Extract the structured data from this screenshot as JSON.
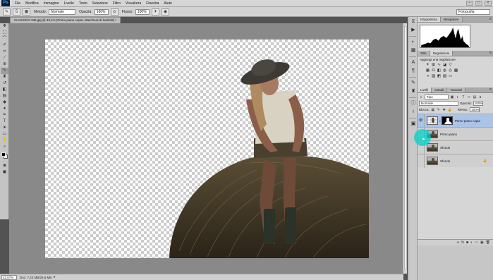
{
  "app": {
    "logo": "Ps"
  },
  "menu": [
    "File",
    "Modifica",
    "Immagine",
    "Livello",
    "Testo",
    "Selezione",
    "Filtro",
    "Visualizza",
    "Finestra",
    "Aiuto"
  ],
  "options": {
    "brush_size": "5",
    "mode_label": "Metodo:",
    "mode_value": "Normale",
    "opacity_label": "Opacità:",
    "opacity_value": "100%",
    "flow_label": "Flusso:",
    "flow_value": "100%",
    "workspace": "Fotografia"
  },
  "document": {
    "tab_title": "CLASSICO 336.jpg @ 43,1% (Primo piano copia, Maschera di livello/8) *",
    "zoom": "43,07%",
    "doc_info": "Doc: 7,43 MB/26,5 MB"
  },
  "panels": {
    "top_tabs": [
      "Istogramma",
      "Navigatore"
    ],
    "adj_tabs": [
      "Stile",
      "Regolazioni"
    ],
    "adj_title": "Aggiungi una regolazione",
    "layer_tabs": [
      "Livelli",
      "Canali",
      "Tracciati"
    ],
    "filter_value": "Tipo",
    "blend_value": "Normale",
    "opacity_label": "Opacità:",
    "opacity_value": "100%",
    "lock_label": "Blocca:",
    "fill_label": "Riemp.:",
    "fill_value": "100%"
  },
  "layers": [
    {
      "name": "Primo piano copia",
      "visible": true,
      "selected": true,
      "mask": true
    },
    {
      "name": "Primo piano",
      "visible": false,
      "selected": false,
      "mask": false
    },
    {
      "name": "Sfondo",
      "visible": false,
      "selected": false,
      "mask": false
    },
    {
      "name": "Sfondo",
      "visible": false,
      "selected": false,
      "mask": false,
      "locked": true
    }
  ],
  "colors": {
    "accent": "#a9c4e6",
    "cursor_highlight": "#00d2c8"
  }
}
